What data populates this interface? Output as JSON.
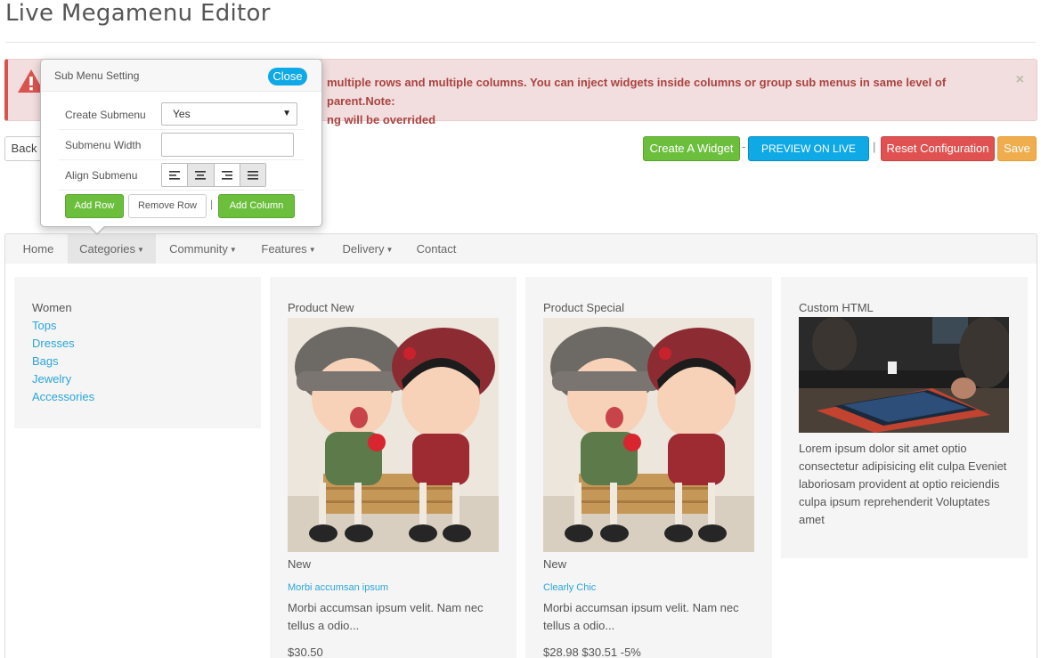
{
  "page": {
    "title": "Live Megamenu Editor"
  },
  "alert": {
    "text": "multiple rows and multiple columns. You can inject widgets inside columns or group sub menus in same level of parent.Note:",
    "text2": "ng will be overrided",
    "close": "×",
    "color": "#d9534f"
  },
  "toolbar": {
    "back": "Back",
    "create_widget": "Create A Widget",
    "sep1": "-",
    "preview": "PREVIEW ON LIVE SITE",
    "sep2": "|",
    "reset": "Reset Configuration",
    "save": "Save"
  },
  "popover": {
    "title": "Sub Menu Setting",
    "close": "Close",
    "create_submenu_label": "Create Submenu",
    "create_submenu_value": "Yes",
    "submenu_width_label": "Submenu Width",
    "submenu_width_value": "",
    "align_label": "Align Submenu",
    "add_row": "Add Row",
    "remove_row": "Remove Row",
    "sep": "|",
    "add_column": "Add Column"
  },
  "nav": {
    "items": [
      {
        "label": "Home"
      },
      {
        "label": "Categories"
      },
      {
        "label": "Community"
      },
      {
        "label": "Features"
      },
      {
        "label": "Delivery"
      },
      {
        "label": "Contact"
      }
    ]
  },
  "columns": {
    "women": {
      "heading": "Women",
      "links": [
        "Tops",
        "Dresses",
        "Bags",
        "Jewelry",
        "Accessories"
      ]
    },
    "product_new": {
      "heading": "Product New",
      "label": "New",
      "name": "Morbi accumsan ipsum",
      "desc": "Morbi accumsan ipsum velit. Nam nec tellus a odio...",
      "price": "$30.50"
    },
    "product_special": {
      "heading": "Product Special",
      "label": "New",
      "name": "Clearly Chic",
      "desc": "Morbi accumsan ipsum velit. Nam nec tellus a odio...",
      "price": "$28.98 $30.51 -5%"
    },
    "custom_html": {
      "heading": "Custom HTML",
      "text": "Lorem ipsum dolor sit amet optio consectetur adipisicing elit culpa Eveniet laboriosam provident at optio reiciendis culpa ipsum reprehenderit Voluptates amet"
    }
  }
}
